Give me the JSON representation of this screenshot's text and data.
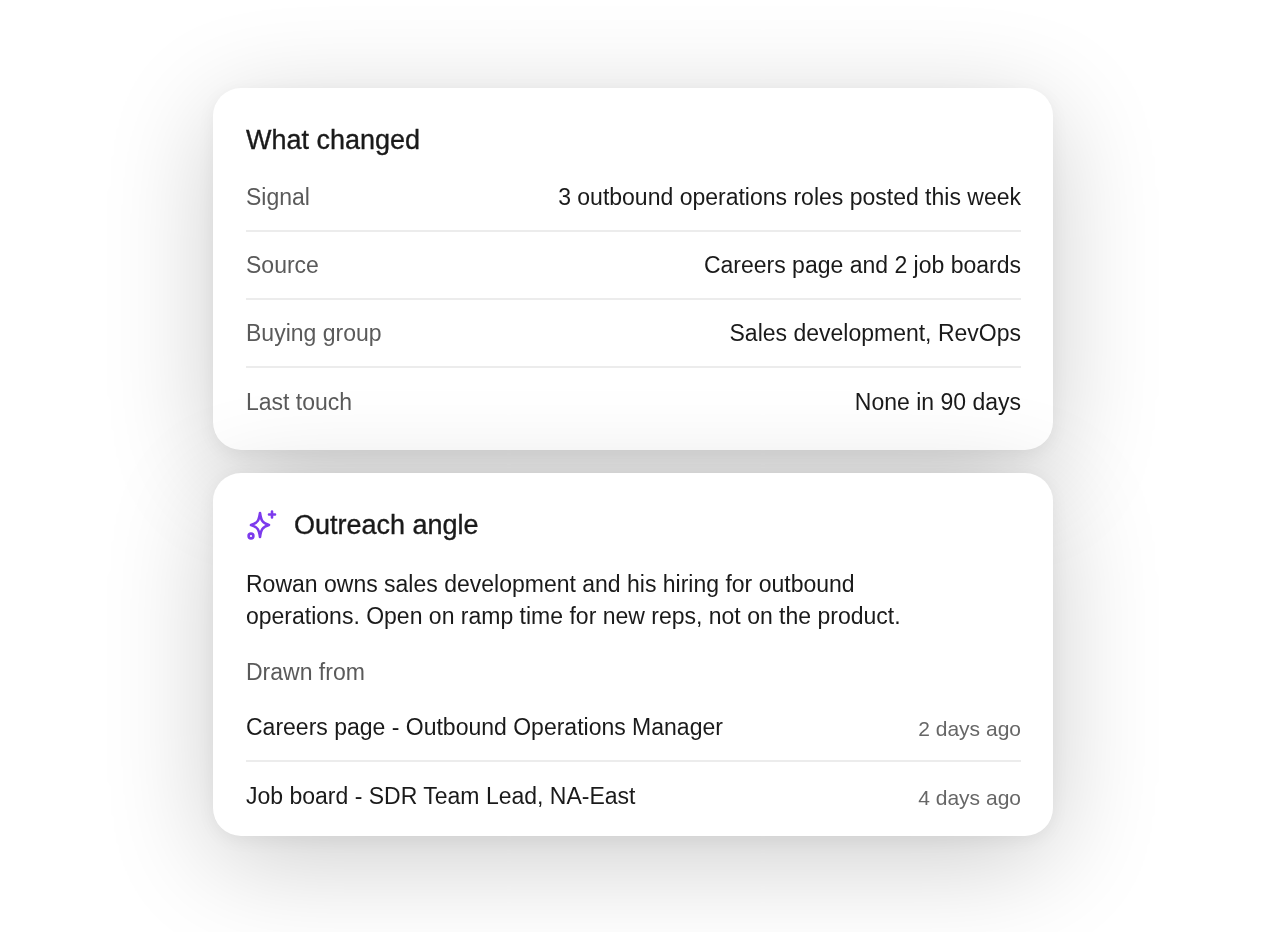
{
  "what_changed": {
    "title": "What changed",
    "rows": [
      {
        "label": "Signal",
        "value": "3 outbound operations roles posted this week"
      },
      {
        "label": "Source",
        "value": "Careers page and 2 job boards"
      },
      {
        "label": "Buying group",
        "value": "Sales development, RevOps"
      },
      {
        "label": "Last touch",
        "value": "None in 90 days"
      }
    ]
  },
  "outreach_angle": {
    "title": "Outreach angle",
    "body": "Rowan owns sales development and his hiring for outbound operations. Open on ramp time for new reps, not on the product.",
    "sources_label": "Drawn from",
    "sources": [
      {
        "title": "Careers page - Outbound Operations Manager",
        "age": "2 days ago"
      },
      {
        "title": "Job board - SDR Team Lead, NA-East",
        "age": "4 days ago"
      }
    ]
  }
}
